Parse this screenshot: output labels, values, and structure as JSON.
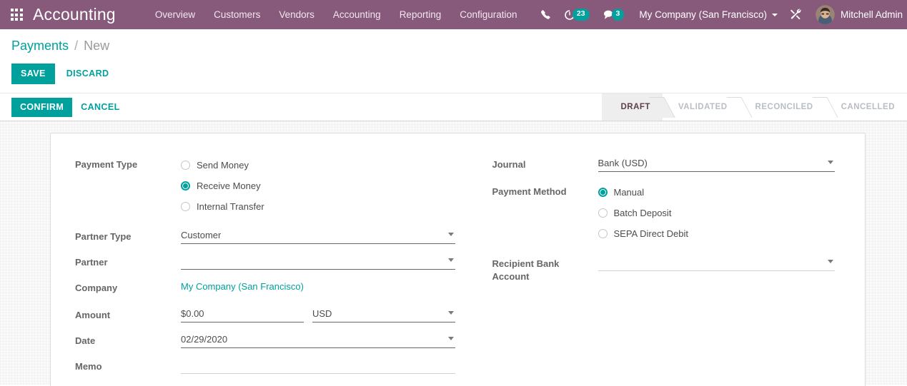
{
  "navbar": {
    "apps_icon": "apps-grid-icon",
    "brand": "Accounting",
    "menu": [
      {
        "label": "Overview"
      },
      {
        "label": "Customers"
      },
      {
        "label": "Vendors"
      },
      {
        "label": "Accounting"
      },
      {
        "label": "Reporting"
      },
      {
        "label": "Configuration"
      }
    ],
    "phone_icon": "phone-icon",
    "activity_icon": "activity-clock-icon",
    "activity_count": "23",
    "messages_icon": "messages-bubble-icon",
    "messages_count": "3",
    "company": "My Company (San Francisco)",
    "tools_icon": "developer-tools-icon",
    "user": "Mitchell Admin",
    "avatar_icon": "user-avatar"
  },
  "breadcrumb": {
    "root": "Payments",
    "separator": "/",
    "current": "New"
  },
  "control_buttons": {
    "save": "SAVE",
    "discard": "DISCARD"
  },
  "statusbar_buttons": {
    "confirm": "CONFIRM",
    "cancel": "CANCEL"
  },
  "statusbar": {
    "stages": [
      {
        "label": "DRAFT",
        "active": true
      },
      {
        "label": "VALIDATED",
        "active": false
      },
      {
        "label": "RECONCILED",
        "active": false
      },
      {
        "label": "CANCELLED",
        "active": false
      }
    ]
  },
  "form": {
    "payment_type": {
      "label": "Payment Type",
      "options": [
        {
          "label": "Send Money",
          "selected": false
        },
        {
          "label": "Receive Money",
          "selected": true
        },
        {
          "label": "Internal Transfer",
          "selected": false
        }
      ]
    },
    "partner_type": {
      "label": "Partner Type",
      "value": "Customer"
    },
    "partner": {
      "label": "Partner",
      "value": ""
    },
    "company": {
      "label": "Company",
      "value": "My Company (San Francisco)"
    },
    "amount": {
      "label": "Amount",
      "value": "$0.00",
      "currency": "USD"
    },
    "date": {
      "label": "Date",
      "value": "02/29/2020"
    },
    "memo": {
      "label": "Memo",
      "value": ""
    },
    "journal": {
      "label": "Journal",
      "value": "Bank (USD)"
    },
    "payment_method": {
      "label": "Payment Method",
      "options": [
        {
          "label": "Manual",
          "selected": true
        },
        {
          "label": "Batch Deposit",
          "selected": false
        },
        {
          "label": "SEPA Direct Debit",
          "selected": false
        }
      ]
    },
    "recipient_bank_account": {
      "label_line1": "Recipient Bank",
      "label_line2": "Account",
      "value": ""
    }
  },
  "colors": {
    "brand_purple": "#875A7B",
    "accent_teal": "#00A09D",
    "label_grey": "#666666",
    "stage_inactive": "#b9bdc4"
  }
}
